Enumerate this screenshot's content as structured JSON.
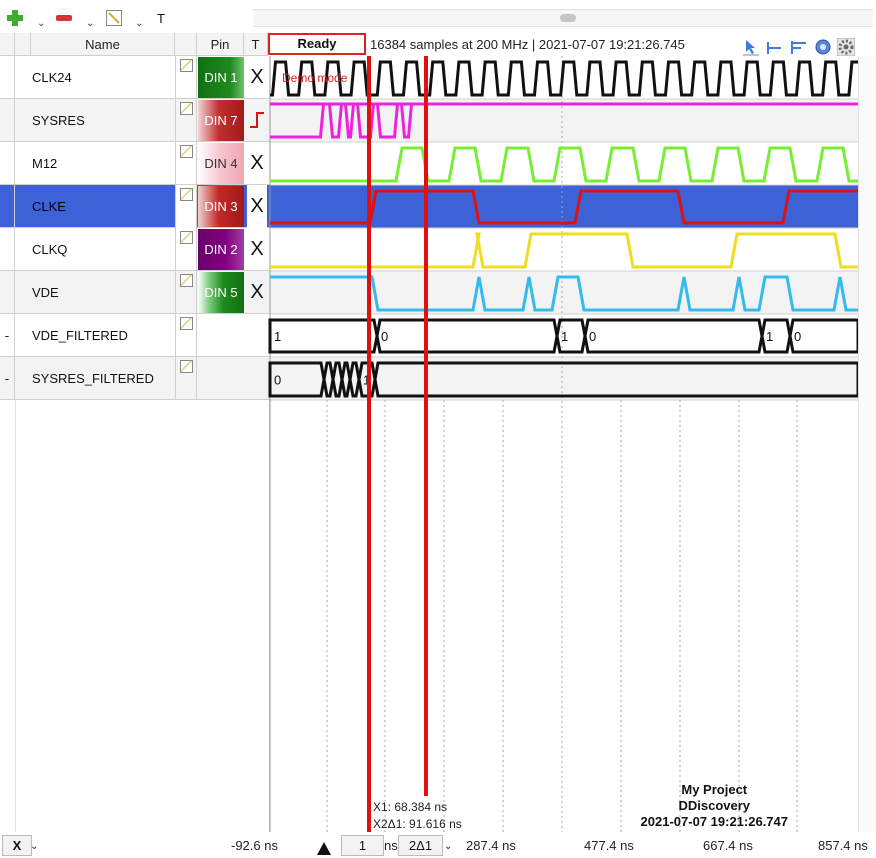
{
  "toolbar": {
    "add_icon": "plus-icon",
    "remove_icon": "minus-icon",
    "edit_icon": "pencil-icon",
    "text_label": "T"
  },
  "columns": {
    "name": "Name",
    "pin": "Pin",
    "trigger": "T"
  },
  "status": "Ready",
  "info": "16384 samples at 200 MHz | 2021-07-07 19:21:26.745",
  "demo_label": "Demo mode",
  "signals": [
    {
      "name": "CLK24",
      "pin": "DIN  1",
      "trigger": "X",
      "prefix": ""
    },
    {
      "name": "SYSRES",
      "pin": "DIN  7",
      "trigger": "",
      "prefix": ""
    },
    {
      "name": "M12",
      "pin": "DIN  4",
      "trigger": "X",
      "prefix": ""
    },
    {
      "name": "CLKE",
      "pin": "DIN  3",
      "trigger": "X",
      "prefix": ""
    },
    {
      "name": "CLKQ",
      "pin": "DIN  2",
      "trigger": "X",
      "prefix": ""
    },
    {
      "name": "VDE",
      "pin": "DIN  5",
      "trigger": "X",
      "prefix": ""
    },
    {
      "name": "VDE_FILTERED",
      "pin": "",
      "trigger": "",
      "prefix": "-"
    },
    {
      "name": "SYSRES_FILTERED",
      "pin": "",
      "trigger": "",
      "prefix": "-"
    }
  ],
  "pin_colors": {
    "din1": "#1a7a1a",
    "din7": "#b02020",
    "din4": "#f2b8c0",
    "din3": "#b02020",
    "din2": "#800080",
    "din5": "#1a7a1a"
  },
  "wave_colors": {
    "clk24": "#111111",
    "sysres": "#ee22dd",
    "m12": "#77ee33",
    "clke": "#dd1111",
    "clkq": "#eedd22",
    "vde": "#33bbee"
  },
  "bus_values": {
    "vde_filtered": [
      "1",
      "0",
      "1",
      "0",
      "1",
      "0"
    ],
    "sysres_filtered": [
      "0",
      "1"
    ]
  },
  "cursors": {
    "x1_label": "X1: 68.384 ns",
    "x2_label": "X2Δ1: 91.616 ns"
  },
  "project": {
    "name": "My Project",
    "device": "DDiscovery",
    "timestamp": "2021-07-07 19:21:26.747"
  },
  "bottom": {
    "x_button": "X",
    "t0": "-92.6 ns",
    "cursor1": "1",
    "ns_unit": "ns",
    "cursor2": "2Δ1",
    "t1": "287.4 ns",
    "t2": "477.4 ns",
    "t3": "667.4 ns",
    "t4": "857.4 ns"
  }
}
